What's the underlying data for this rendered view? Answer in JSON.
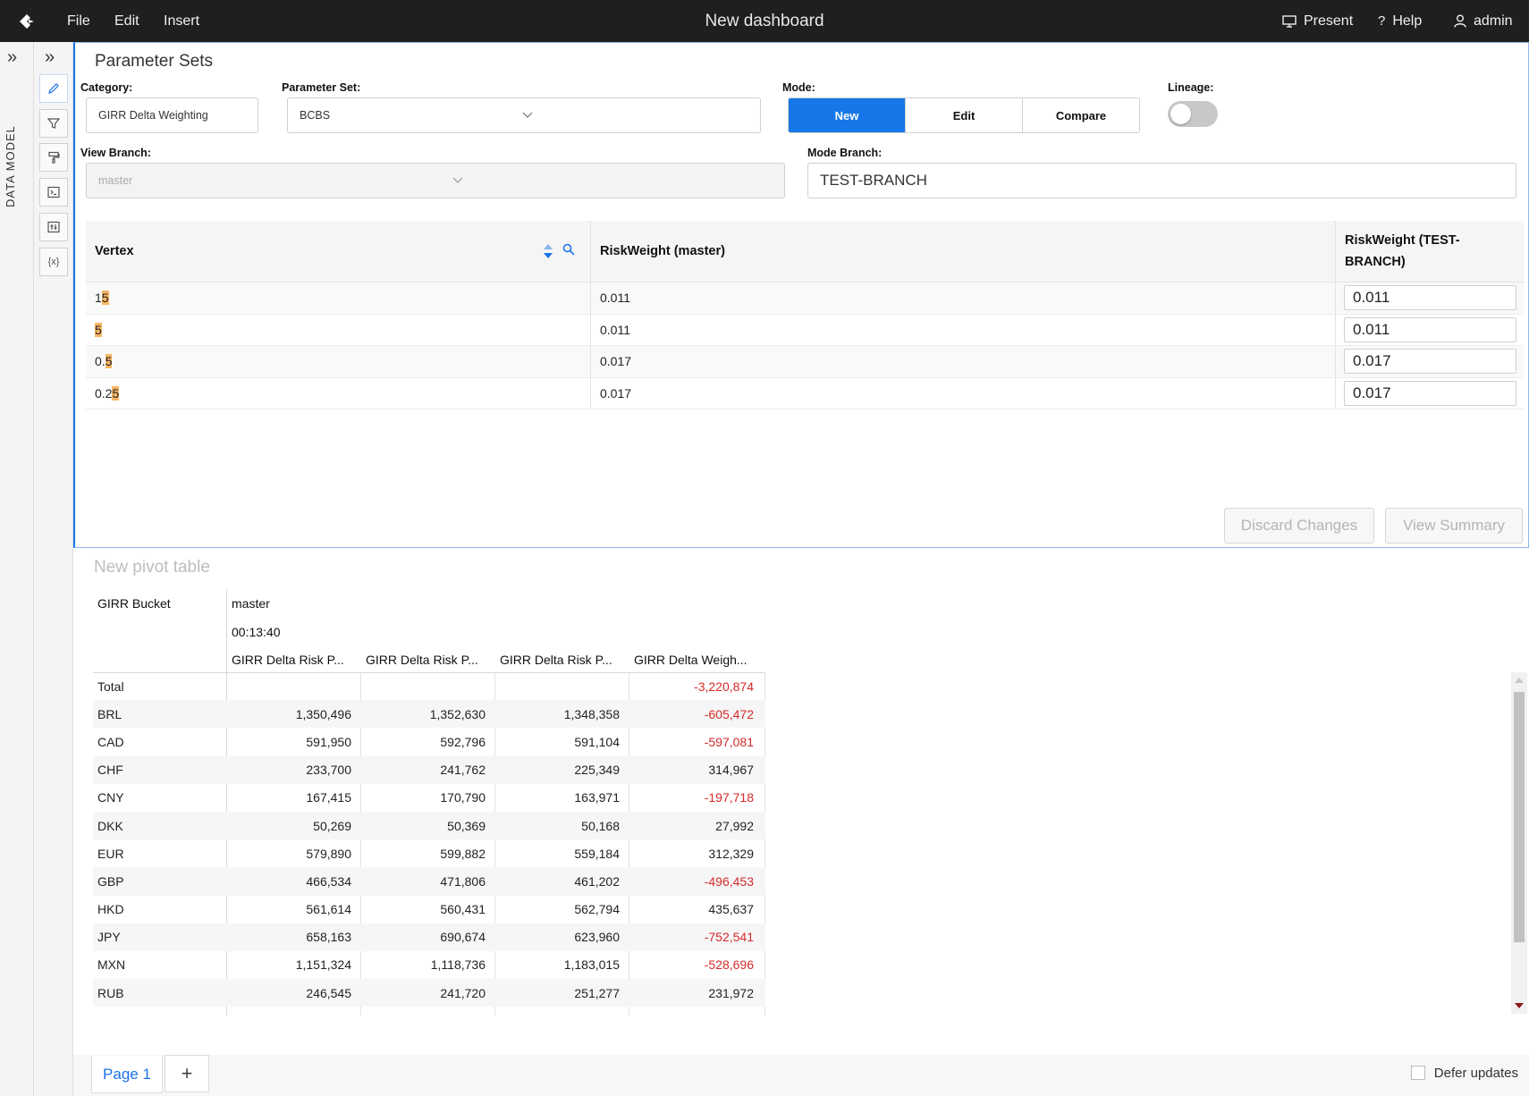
{
  "app": {
    "title": "New dashboard",
    "menu": [
      "File",
      "Edit",
      "Insert"
    ],
    "right": {
      "present": "Present",
      "help": "Help",
      "user": "admin"
    }
  },
  "sidebar": {
    "label": "DATA MODEL"
  },
  "param_panel": {
    "title": "Parameter Sets",
    "category_label": "Category:",
    "category_value": "GIRR Delta Weighting",
    "paramset_label": "Parameter Set:",
    "paramset_value": "BCBS",
    "mode_label": "Mode:",
    "modes": [
      "New",
      "Edit",
      "Compare"
    ],
    "mode_selected": "New",
    "lineage_label": "Lineage:",
    "lineage_on": false,
    "view_branch_label": "View Branch:",
    "view_branch_value": "master",
    "mode_branch_label": "Mode Branch:",
    "mode_branch_value": "TEST-BRANCH",
    "table": {
      "headers": {
        "vertex": "Vertex",
        "rw_master": "RiskWeight (master)",
        "rw_test_1": "RiskWeight (TEST-",
        "rw_test_2": "BRANCH)"
      },
      "rows": [
        {
          "vertex_pre": "1",
          "vertex_hl": "5",
          "master": "0.011",
          "test": "0.011"
        },
        {
          "vertex_pre": "",
          "vertex_hl": "5",
          "master": "0.011",
          "test": "0.011"
        },
        {
          "vertex_pre": "0.",
          "vertex_hl": "5",
          "master": "0.017",
          "test": "0.017"
        },
        {
          "vertex_pre": "0.2",
          "vertex_hl": "5",
          "master": "0.017",
          "test": "0.017"
        }
      ]
    },
    "discard_label": "Discard Changes",
    "summary_label": "View Summary"
  },
  "pivot": {
    "title": "New pivot table",
    "row_header": "GIRR Bucket",
    "branch": "master",
    "time": "00:13:40",
    "columns": [
      "GIRR Delta Risk P...",
      "GIRR Delta Risk P...",
      "GIRR Delta Risk P...",
      "GIRR Delta Weigh..."
    ],
    "rows": [
      {
        "label": "Total",
        "v1": "",
        "v2": "",
        "v3": "",
        "v4": "-3,220,874",
        "neg": true
      },
      {
        "label": "BRL",
        "v1": "1,350,496",
        "v2": "1,352,630",
        "v3": "1,348,358",
        "v4": "-605,472",
        "neg": true
      },
      {
        "label": "CAD",
        "v1": "591,950",
        "v2": "592,796",
        "v3": "591,104",
        "v4": "-597,081",
        "neg": true
      },
      {
        "label": "CHF",
        "v1": "233,700",
        "v2": "241,762",
        "v3": "225,349",
        "v4": "314,967",
        "neg": false
      },
      {
        "label": "CNY",
        "v1": "167,415",
        "v2": "170,790",
        "v3": "163,971",
        "v4": "-197,718",
        "neg": true
      },
      {
        "label": "DKK",
        "v1": "50,269",
        "v2": "50,369",
        "v3": "50,168",
        "v4": "27,992",
        "neg": false
      },
      {
        "label": "EUR",
        "v1": "579,890",
        "v2": "599,882",
        "v3": "559,184",
        "v4": "312,329",
        "neg": false
      },
      {
        "label": "GBP",
        "v1": "466,534",
        "v2": "471,806",
        "v3": "461,202",
        "v4": "-496,453",
        "neg": true
      },
      {
        "label": "HKD",
        "v1": "561,614",
        "v2": "560,431",
        "v3": "562,794",
        "v4": "435,637",
        "neg": false
      },
      {
        "label": "JPY",
        "v1": "658,163",
        "v2": "690,674",
        "v3": "623,960",
        "v4": "-752,541",
        "neg": true
      },
      {
        "label": "MXN",
        "v1": "1,151,324",
        "v2": "1,118,736",
        "v3": "1,183,015",
        "v4": "-528,696",
        "neg": true
      },
      {
        "label": "RUB",
        "v1": "246,545",
        "v2": "241,720",
        "v3": "251,277",
        "v4": "231,972",
        "neg": false
      }
    ]
  },
  "footer": {
    "page_tab": "Page 1",
    "add_tab": "+",
    "defer_label": "Defer updates"
  },
  "colors": {
    "accent": "#1677e8",
    "negative": "#d42a2a",
    "highlight": "#f7b564"
  }
}
